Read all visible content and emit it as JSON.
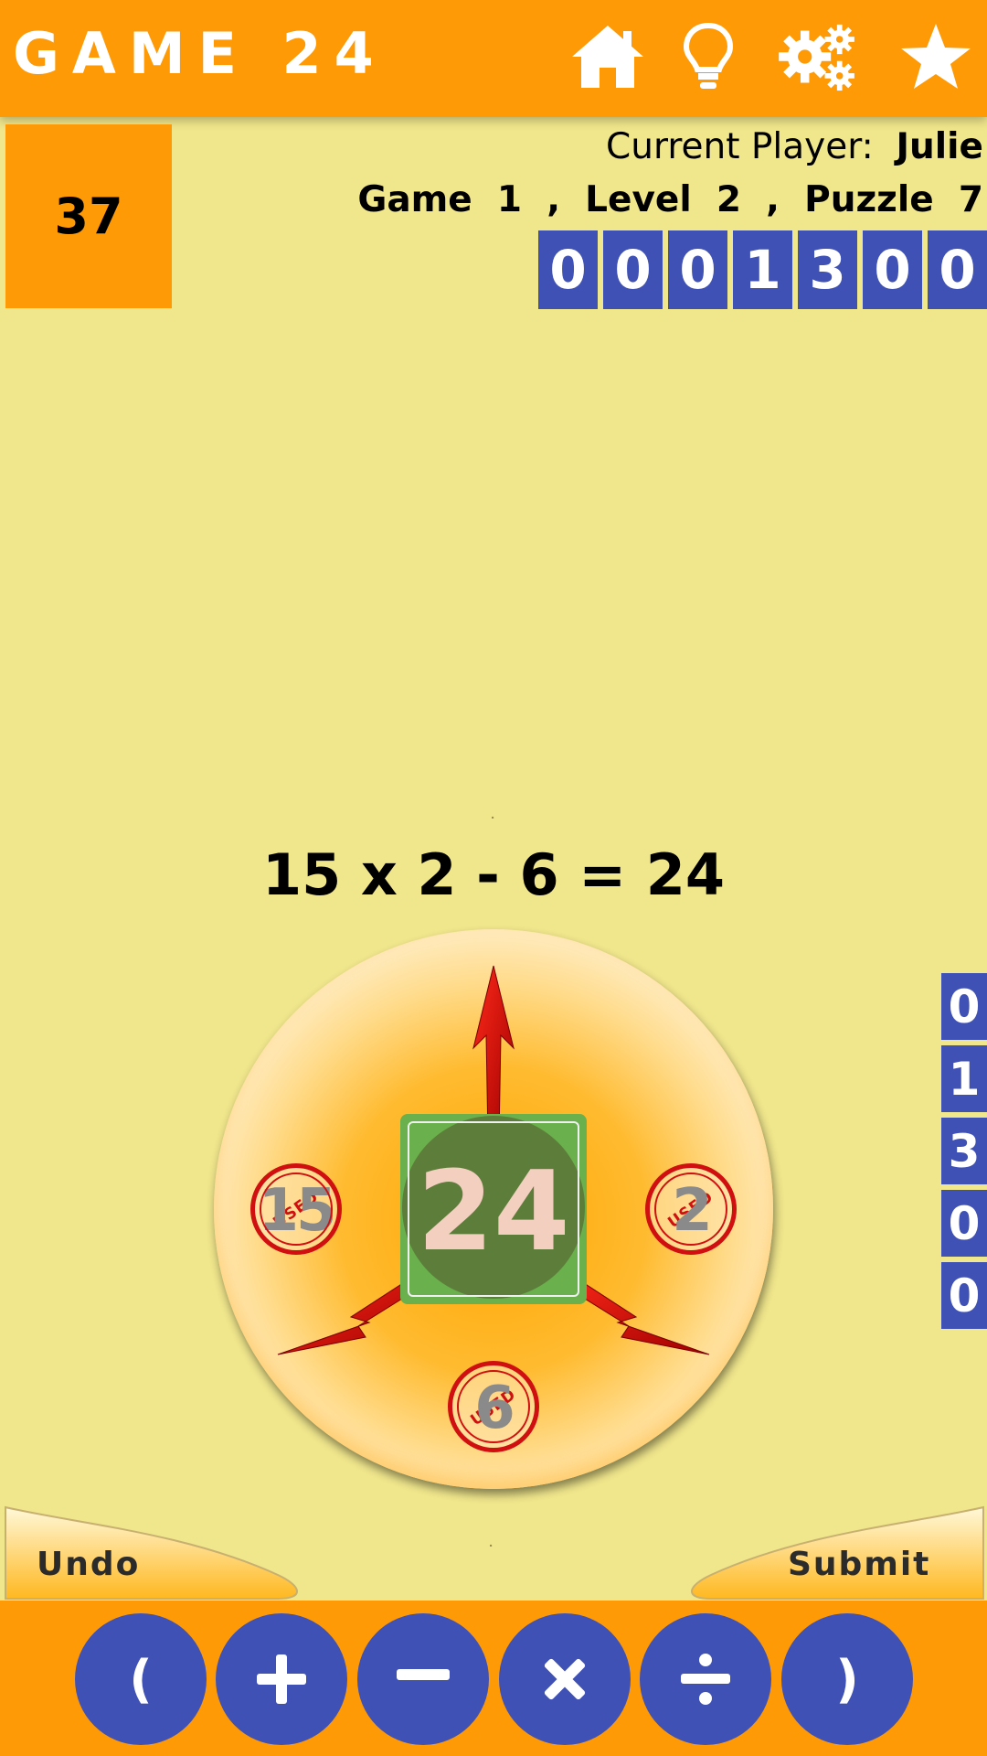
{
  "header": {
    "title": "GAME 24",
    "icons": [
      "home-icon",
      "lightbulb-icon",
      "gears-icon",
      "star-icon"
    ],
    "bg_color": "#fe9a06"
  },
  "timer": {
    "value": "37"
  },
  "status": {
    "player_label": "Current Player:",
    "player_name": "Julie",
    "game_line": "Game  1  ,  Level  2  ,  Puzzle  7"
  },
  "score": {
    "digits": [
      "0",
      "0",
      "0",
      "1",
      "3",
      "0",
      "0"
    ]
  },
  "side_score": {
    "digits": [
      "0",
      "1",
      "3",
      "0",
      "0"
    ]
  },
  "equation": "15 x 2 - 6 = 24",
  "wheel": {
    "tokens": [
      {
        "value": "15",
        "stamp": "USED"
      },
      {
        "value": "2",
        "stamp": "USED"
      },
      {
        "value": "6",
        "stamp": "USED"
      }
    ],
    "center_value": "24"
  },
  "buttons": {
    "undo": "Undo",
    "submit": "Submit"
  },
  "operators": {
    "open_paren": "(",
    "plus": "plus-icon",
    "minus": "minus-icon",
    "times": "times-icon",
    "divide": "divide-icon",
    "close_paren": ")"
  },
  "colors": {
    "accent": "#fe9a06",
    "digit": "#3f51b5",
    "background": "#f0e68c",
    "token_ring": "#d01010",
    "target": "#6ab04c"
  }
}
